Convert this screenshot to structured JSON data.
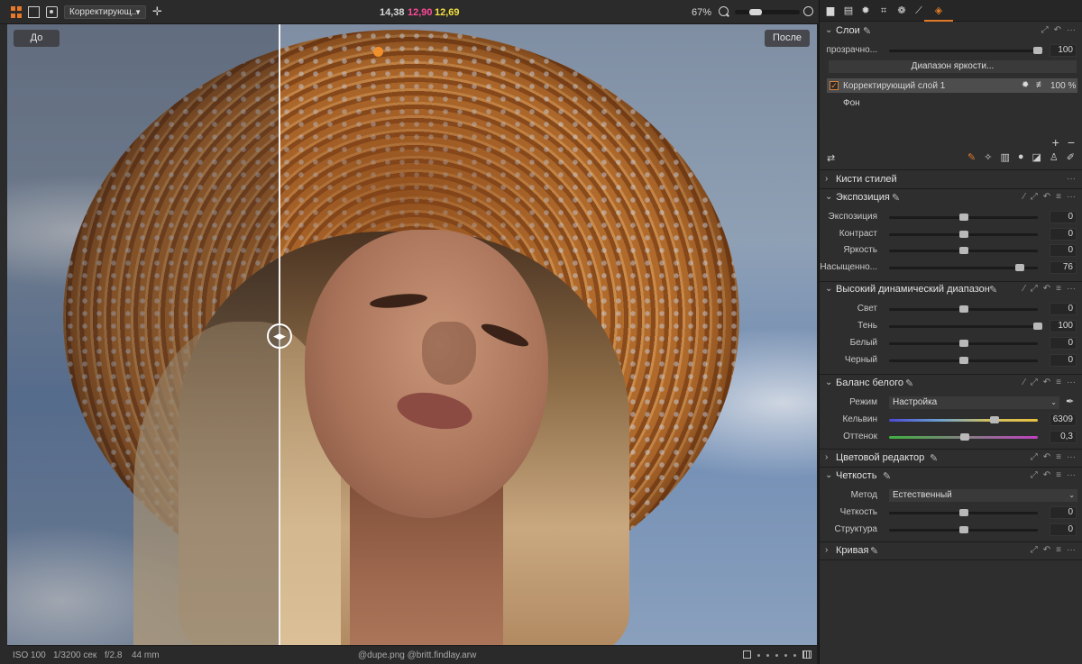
{
  "toolbar": {
    "layer_dropdown": "Корректирующ...",
    "readout": {
      "v1": "14,38",
      "v2": "12,90",
      "v3": "12,69"
    },
    "zoom": "67%",
    "zoom_slider_level": 0.28
  },
  "viewer": {
    "before_label": "До",
    "after_label": "После"
  },
  "statusbar": {
    "iso": "ISO 100",
    "shutter": "1/3200 сек",
    "aperture": "f/2.8",
    "focal": "44 mm",
    "filename": "@dupe.png @britt.findlay.arw"
  },
  "colors": {
    "accent": "#e07a28",
    "readout_magenta": "#ff4a9a",
    "readout_yellow": "#f2e040"
  },
  "panel": {
    "tabs": [
      "folder-icon",
      "clipboard-icon",
      "sun-icon",
      "crop-icon",
      "lens-icon",
      "brush-tool-icon",
      "layers-icon"
    ],
    "layers": {
      "title": "Слои",
      "opacity_label": "прозрачно...",
      "opacity_value": "100",
      "opacity_level": 1.0,
      "luma_button": "Диапазон яркости...",
      "items": [
        {
          "name": "Корректирующий слой 1",
          "percent": "100 %",
          "checked": true
        },
        {
          "name": "Фон"
        }
      ]
    },
    "styles_brush": {
      "title": "Кисти стилей"
    },
    "exposure": {
      "title": "Экспозиция",
      "rows": [
        {
          "label": "Экспозиция",
          "value": "0",
          "level": 0.5
        },
        {
          "label": "Контраст",
          "value": "0",
          "level": 0.5
        },
        {
          "label": "Яркость",
          "value": "0",
          "level": 0.5
        },
        {
          "label": "Насыщенно...",
          "value": "76",
          "level": 0.88
        }
      ]
    },
    "hdr": {
      "title": "Высокий динамический диапазон",
      "rows": [
        {
          "label": "Свет",
          "value": "0",
          "level": 0.5
        },
        {
          "label": "Тень",
          "value": "100",
          "level": 1.0
        },
        {
          "label": "Белый",
          "value": "0",
          "level": 0.5
        },
        {
          "label": "Черный",
          "value": "0",
          "level": 0.5
        }
      ]
    },
    "wb": {
      "title": "Баланс белого",
      "mode_label": "Режим",
      "mode_value": "Настройка",
      "kelvin_label": "Кельвин",
      "kelvin_value": "6309",
      "kelvin_level": 0.71,
      "tint_label": "Оттенок",
      "tint_value": "0,3",
      "tint_level": 0.51
    },
    "color_editor": {
      "title": "Цветовой редактор"
    },
    "clarity": {
      "title": "Четкость",
      "method_label": "Метод",
      "method_value": "Естественный",
      "rows": [
        {
          "label": "Четкость",
          "value": "0",
          "level": 0.5
        },
        {
          "label": "Структура",
          "value": "0",
          "level": 0.5
        }
      ]
    },
    "curve": {
      "title": "Кривая"
    }
  }
}
